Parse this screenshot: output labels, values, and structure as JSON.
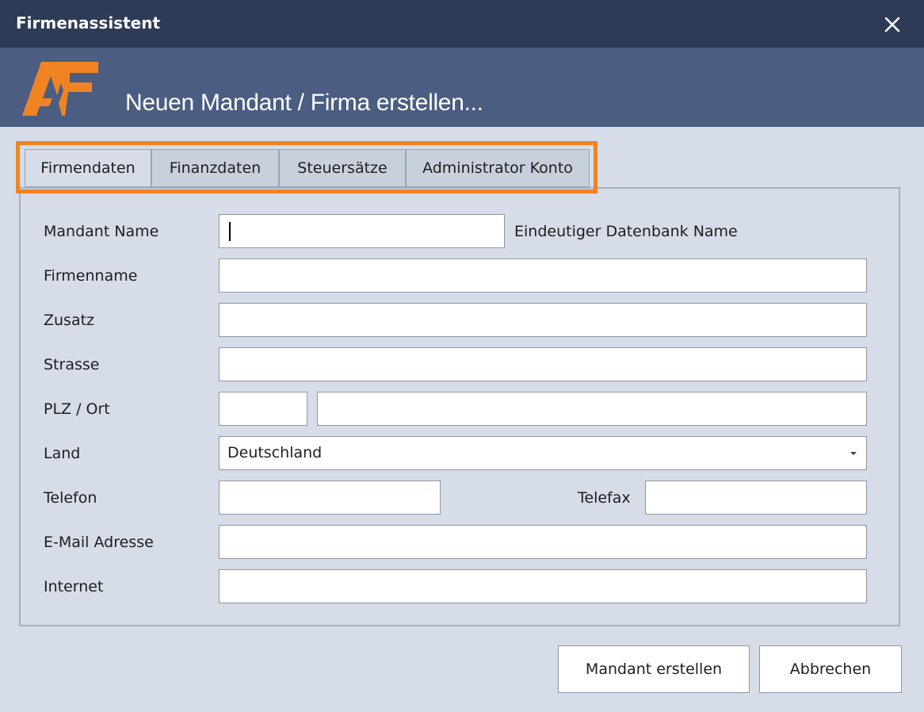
{
  "window": {
    "title": "Firmenassistent",
    "close_icon": "close-icon"
  },
  "header": {
    "logo_icon": "af-logo-icon",
    "title": "Neuen Mandant / Firma erstellen..."
  },
  "tabs": [
    {
      "label": "Firmendaten",
      "active": true
    },
    {
      "label": "Finanzdaten",
      "active": false
    },
    {
      "label": "Steuersätze",
      "active": false
    },
    {
      "label": "Administrator Konto",
      "active": false
    }
  ],
  "form": {
    "mandant_name": {
      "label": "Mandant Name",
      "value": "",
      "hint": "Eindeutiger Datenbank Name"
    },
    "firmenname": {
      "label": "Firmenname",
      "value": ""
    },
    "zusatz": {
      "label": "Zusatz",
      "value": ""
    },
    "strasse": {
      "label": "Strasse",
      "value": ""
    },
    "plz_ort": {
      "label": "PLZ / Ort",
      "plz_value": "",
      "ort_value": ""
    },
    "land": {
      "label": "Land",
      "value": "Deutschland"
    },
    "telefon": {
      "label": "Telefon",
      "value": ""
    },
    "telefax": {
      "label": "Telefax",
      "value": ""
    },
    "email": {
      "label": "E-Mail Adresse",
      "value": ""
    },
    "internet": {
      "label": "Internet",
      "value": ""
    }
  },
  "buttons": {
    "create": "Mandant erstellen",
    "cancel": "Abbrechen"
  },
  "colors": {
    "titlebar": "#2d3b57",
    "header": "#4b5d80",
    "accent_orange": "#f08422",
    "background": "#d6dce8"
  }
}
